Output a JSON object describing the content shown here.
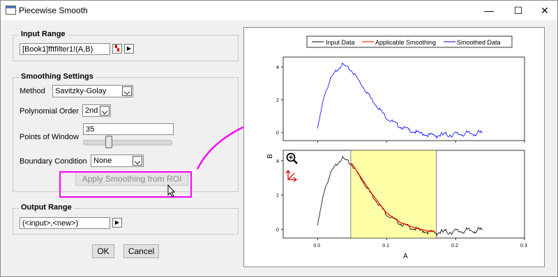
{
  "window": {
    "title": "Piecewise Smooth",
    "minimize": "—",
    "maximize": "☐",
    "close": "✕"
  },
  "input_range": {
    "legend": "Input Range",
    "value": "[Book1]fftfilter1!(A,B)"
  },
  "smoothing": {
    "legend": "Smoothing Settings",
    "method_label": "Method",
    "method_value": "Savitzky-Golay",
    "poly_label": "Polynomial Order",
    "poly_value": "2nd",
    "points_label": "Points of Window",
    "points_value": "35",
    "points_slider_fraction": 0.27,
    "boundary_label": "Boundary Condition",
    "boundary_value": "None",
    "apply_button": "Apply Smoothing from ROI"
  },
  "output_range": {
    "legend": "Output Range",
    "value": "(<input>,<new>)"
  },
  "buttons": {
    "ok": "OK",
    "cancel": "Cancel"
  },
  "chart_data": {
    "type": "line",
    "legend": [
      "Input Data",
      "Applicable Smoothing",
      "Smoothed Data"
    ],
    "colors": {
      "input": "#000000",
      "applicable": "#ff0000",
      "smoothed": "#0000ff",
      "roi": "#ffffa8",
      "annotation_arrow": "#ff00ff"
    },
    "xlabel": "A",
    "ylabel": "B",
    "xlim": [
      -0.05,
      0.3
    ],
    "ylim": [
      -0.5,
      4.6
    ],
    "xticks": [
      "0.0",
      "0.1",
      "0.2",
      "0.3"
    ],
    "yticks": [
      "0",
      "2",
      "4"
    ],
    "roi": [
      0.048,
      0.172
    ],
    "curve": {
      "x": [
        0,
        0.01,
        0.02,
        0.03,
        0.035,
        0.04,
        0.05,
        0.06,
        0.08,
        0.1,
        0.12,
        0.14,
        0.16,
        0.17,
        0.19,
        0.21,
        0.24
      ],
      "y": [
        0.3,
        2.4,
        3.4,
        4.0,
        4.2,
        4.1,
        3.8,
        3.2,
        2.0,
        0.95,
        0.4,
        0.1,
        -0.1,
        -0.1,
        -0.05,
        0.0,
        0.05
      ]
    }
  }
}
